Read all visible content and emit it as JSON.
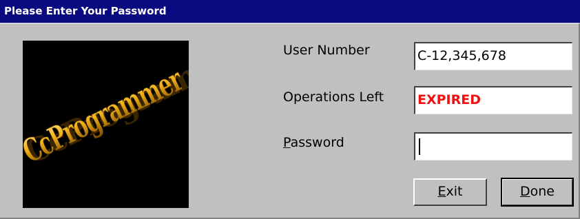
{
  "window": {
    "title": "Please Enter Your Password"
  },
  "logo": {
    "text": "CcProgrammer"
  },
  "form": {
    "user_number_label": "User Number",
    "user_number_value": "C-12,345,678",
    "operations_left_label": "Operations Left",
    "operations_left_value": "EXPIRED",
    "password_label_first": "P",
    "password_label_rest": "assword",
    "password_value": ""
  },
  "buttons": {
    "exit_first": "E",
    "exit_rest": "xit",
    "done_first": "D",
    "done_rest": "one"
  },
  "colors": {
    "titlebar": "#0a0a80",
    "expired_text": "#ee1111",
    "dialog_bg": "#c0c0c0"
  }
}
